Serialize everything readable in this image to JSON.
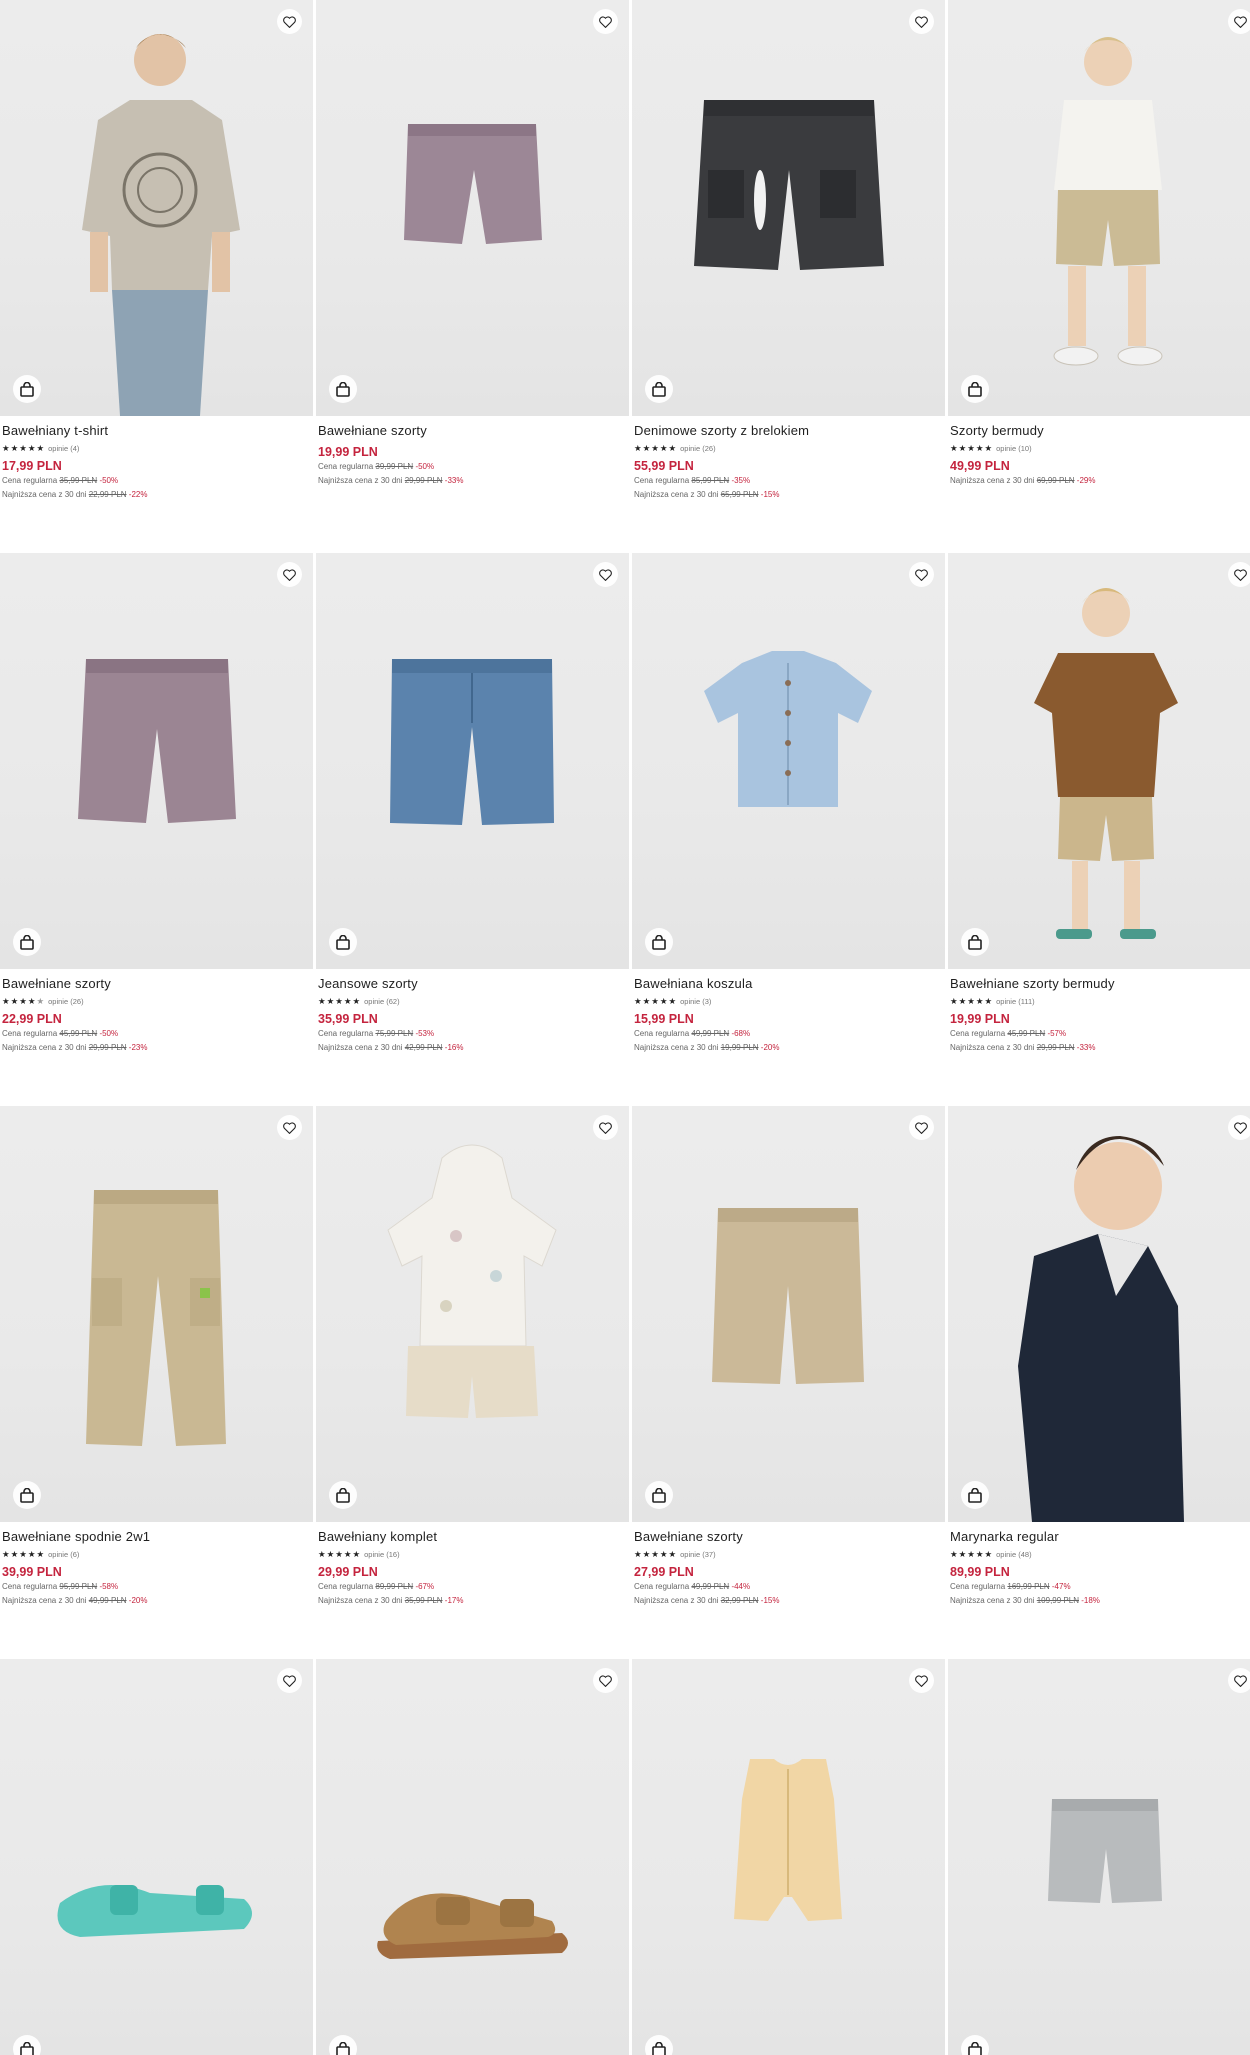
{
  "currency_note": "PLN",
  "colors": {
    "accent": "#c4243e",
    "text": "#1f1f1f",
    "muted": "#666666",
    "photo_bg": "#ebebeb"
  },
  "icons": {
    "favorite": "heart-icon",
    "cart": "shopping-bag-icon",
    "rating": "star-icon"
  },
  "products": [
    {
      "name": "Bawełniany t-shirt",
      "stars": 5,
      "reviews": "opinie (4)",
      "price": "17,99 PLN",
      "regular_label": "Cena regularna",
      "regular_price": "35,99 PLN",
      "regular_pct": "-50%",
      "lowest_label": "Najniższa cena z 30 dni",
      "lowest_price": "22,99 PLN",
      "lowest_pct": "-22%"
    },
    {
      "name": "Bawełniane szorty",
      "stars": 0,
      "reviews": "",
      "price": "19,99 PLN",
      "regular_label": "Cena regularna",
      "regular_price": "39,99 PLN",
      "regular_pct": "-50%",
      "lowest_label": "Najniższa cena z 30 dni",
      "lowest_price": "29,99 PLN",
      "lowest_pct": "-33%"
    },
    {
      "name": "Denimowe szorty z brelokiem",
      "stars": 5,
      "reviews": "opinie (26)",
      "price": "55,99 PLN",
      "regular_label": "Cena regularna",
      "regular_price": "85,99 PLN",
      "regular_pct": "-35%",
      "lowest_label": "Najniższa cena z 30 dni",
      "lowest_price": "65,99 PLN",
      "lowest_pct": "-15%"
    },
    {
      "name": "Szorty bermudy",
      "stars": 5,
      "reviews": "opinie (10)",
      "price": "49,99 PLN",
      "regular_label": "",
      "regular_price": "",
      "regular_pct": "",
      "lowest_label": "Najniższa cena z 30 dni",
      "lowest_price": "69,99 PLN",
      "lowest_pct": "-29%"
    },
    {
      "name": "Bawełniane szorty",
      "stars": 4.5,
      "reviews": "opinie (26)",
      "price": "22,99 PLN",
      "regular_label": "Cena regularna",
      "regular_price": "45,99 PLN",
      "regular_pct": "-50%",
      "lowest_label": "Najniższa cena z 30 dni",
      "lowest_price": "29,99 PLN",
      "lowest_pct": "-23%"
    },
    {
      "name": "Jeansowe szorty",
      "stars": 5,
      "reviews": "opinie (62)",
      "price": "35,99 PLN",
      "regular_label": "Cena regularna",
      "regular_price": "75,99 PLN",
      "regular_pct": "-53%",
      "lowest_label": "Najniższa cena z 30 dni",
      "lowest_price": "42,99 PLN",
      "lowest_pct": "-16%"
    },
    {
      "name": "Bawełniana koszula",
      "stars": 5,
      "reviews": "opinie (3)",
      "price": "15,99 PLN",
      "regular_label": "Cena regularna",
      "regular_price": "49,99 PLN",
      "regular_pct": "-68%",
      "lowest_label": "Najniższa cena z 30 dni",
      "lowest_price": "19,99 PLN",
      "lowest_pct": "-20%"
    },
    {
      "name": "Bawełniane szorty bermudy",
      "stars": 5,
      "reviews": "opinie (111)",
      "price": "19,99 PLN",
      "regular_label": "Cena regularna",
      "regular_price": "45,99 PLN",
      "regular_pct": "-57%",
      "lowest_label": "Najniższa cena z 30 dni",
      "lowest_price": "29,99 PLN",
      "lowest_pct": "-33%"
    },
    {
      "name": "Bawełniane spodnie 2w1",
      "stars": 5,
      "reviews": "opinie (6)",
      "price": "39,99 PLN",
      "regular_label": "Cena regularna",
      "regular_price": "95,99 PLN",
      "regular_pct": "-58%",
      "lowest_label": "Najniższa cena z 30 dni",
      "lowest_price": "49,99 PLN",
      "lowest_pct": "-20%"
    },
    {
      "name": "Bawełniany komplet",
      "stars": 5,
      "reviews": "opinie (16)",
      "price": "29,99 PLN",
      "regular_label": "Cena regularna",
      "regular_price": "89,99 PLN",
      "regular_pct": "-67%",
      "lowest_label": "Najniższa cena z 30 dni",
      "lowest_price": "35,99 PLN",
      "lowest_pct": "-17%"
    },
    {
      "name": "Bawełniane szorty",
      "stars": 5,
      "reviews": "opinie (37)",
      "price": "27,99 PLN",
      "regular_label": "Cena regularna",
      "regular_price": "49,99 PLN",
      "regular_pct": "-44%",
      "lowest_label": "Najniższa cena z 30 dni",
      "lowest_price": "32,99 PLN",
      "lowest_pct": "-15%"
    },
    {
      "name": "Marynarka regular",
      "stars": 5,
      "reviews": "opinie (48)",
      "price": "89,99 PLN",
      "regular_label": "Cena regularna",
      "regular_price": "169,99 PLN",
      "regular_pct": "-47%",
      "lowest_label": "Najniższa cena z 30 dni",
      "lowest_price": "109,99 PLN",
      "lowest_pct": "-18%"
    },
    {
      "name": "",
      "stars": 0,
      "reviews": "",
      "price": "",
      "regular_label": "",
      "regular_price": "",
      "regular_pct": "",
      "lowest_label": "",
      "lowest_price": "",
      "lowest_pct": ""
    },
    {
      "name": "",
      "stars": 0,
      "reviews": "",
      "price": "",
      "regular_label": "",
      "regular_price": "",
      "regular_pct": "",
      "lowest_label": "",
      "lowest_price": "",
      "lowest_pct": ""
    },
    {
      "name": "",
      "stars": 0,
      "reviews": "",
      "price": "",
      "regular_label": "",
      "regular_price": "",
      "regular_pct": "",
      "lowest_label": "",
      "lowest_price": "",
      "lowest_pct": ""
    },
    {
      "name": "",
      "stars": 0,
      "reviews": "",
      "price": "",
      "regular_label": "",
      "regular_price": "",
      "regular_pct": "",
      "lowest_label": "",
      "lowest_price": "",
      "lowest_pct": ""
    }
  ]
}
